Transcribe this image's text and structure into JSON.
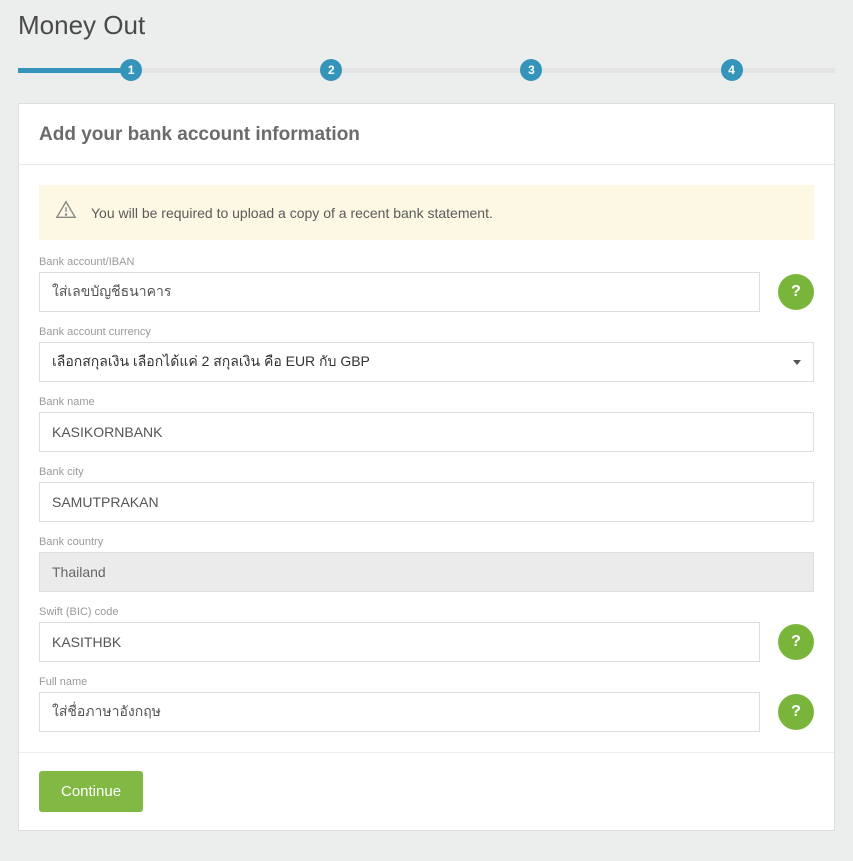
{
  "page_title": "Money Out",
  "stepper": {
    "steps": [
      "1",
      "2",
      "3",
      "4"
    ],
    "active": 1
  },
  "card": {
    "title": "Add your bank account information",
    "alert": "You will be required to upload a copy of a recent bank statement."
  },
  "form": {
    "bank_account": {
      "label": "Bank account/IBAN",
      "value": "ใส่เลขบัญชีธนาคาร",
      "help": "?"
    },
    "currency": {
      "label": "Bank account currency",
      "value": "เลือกสกุลเงิน เลือกได้แค่ 2 สกุลเงิน คือ EUR กับ GBP"
    },
    "bank_name": {
      "label": "Bank name",
      "value": "KASIKORNBANK"
    },
    "bank_city": {
      "label": "Bank city",
      "value": "SAMUTPRAKAN"
    },
    "bank_country": {
      "label": "Bank country",
      "value": "Thailand"
    },
    "swift": {
      "label": "Swift (BIC) code",
      "value": "KASITHBK",
      "help": "?"
    },
    "full_name": {
      "label": "Full name",
      "value": "ใส่ชื่อภาษาอังกฤษ",
      "help": "?"
    }
  },
  "actions": {
    "continue": "Continue"
  }
}
